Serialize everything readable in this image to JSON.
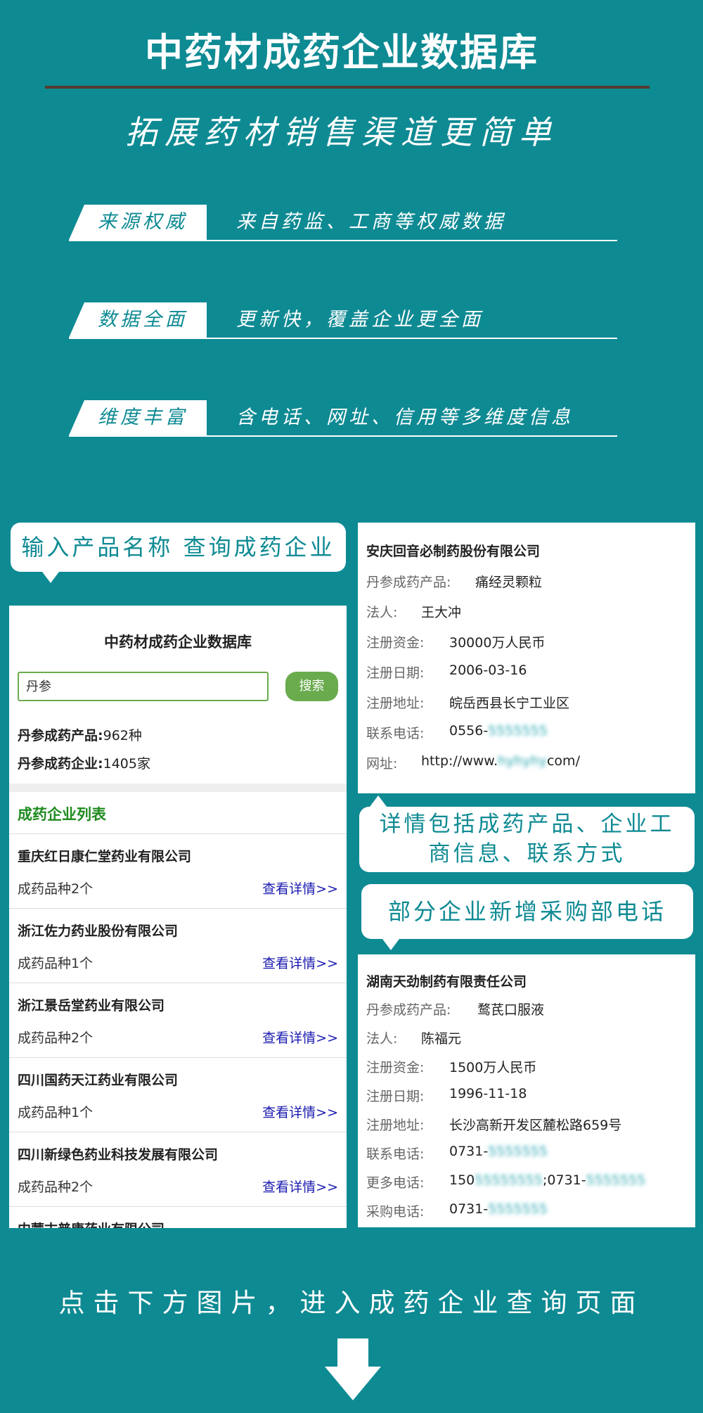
{
  "header": {
    "title": "中药材成药企业数据库",
    "subtitle": "拓展药材销售渠道更简单"
  },
  "features": [
    {
      "tag": "来源权威",
      "desc": "来自药监、工商等权威数据"
    },
    {
      "tag": "数据全面",
      "desc": "更新快，覆盖企业更全面"
    },
    {
      "tag": "维度丰富",
      "desc": "含电话、网址、信用等多维度信息"
    }
  ],
  "callouts": {
    "search_hint": "输入产品名称 查询成药企业",
    "detail_hint_line1": "详情包括成药产品、企业工",
    "detail_hint_line2": "商信息、联系方式",
    "purchase_hint": "部分企业新增采购部电话"
  },
  "search_panel": {
    "title": "中药材成药企业数据库",
    "query": "丹参",
    "search_button": "搜索",
    "product_stat_label": "丹参成药产品:",
    "product_stat_value": "962种",
    "company_stat_label": "丹参成药企业:",
    "company_stat_value": "1405家",
    "list_heading": "成药企业列表",
    "link_label": "查看详情>>",
    "companies": [
      {
        "name": "重庆红日康仁堂药业有限公司",
        "count": "成药品种2个"
      },
      {
        "name": "浙江佐力药业股份有限公司",
        "count": "成药品种1个"
      },
      {
        "name": "浙江景岳堂药业有限公司",
        "count": "成药品种2个"
      },
      {
        "name": "四川国药天江药业有限公司",
        "count": "成药品种1个"
      },
      {
        "name": "四川新绿色药业科技发展有限公司",
        "count": "成药品种2个"
      },
      {
        "name": "内蒙古普康药业有限公司",
        "count": ""
      }
    ]
  },
  "detail_card_1": {
    "company": "安庆回音必制药股份有限公司",
    "rows": [
      {
        "label": "丹参成药产品:",
        "value": "痛经灵颗粒"
      },
      {
        "label": "法人:",
        "value": "王大冲"
      },
      {
        "label": "注册资金:",
        "value": "30000万人民币"
      },
      {
        "label": "注册日期:",
        "value": "2006-03-16"
      },
      {
        "label": "注册地址:",
        "value": "皖岳西县长宁工业区"
      },
      {
        "label": "联系电话:",
        "value": "0556-",
        "blurred": "5555555"
      },
      {
        "label": "网址:",
        "value": "http://www.",
        "blurred": "hyhyhy",
        "suffix": "com/"
      }
    ]
  },
  "detail_card_2": {
    "company": "湖南天劲制药有限责任公司",
    "rows": [
      {
        "label": "丹参成药产品:",
        "value": "鹜芪口服液"
      },
      {
        "label": "法人:",
        "value": "陈福元"
      },
      {
        "label": "注册资金:",
        "value": "1500万人民币"
      },
      {
        "label": "注册日期:",
        "value": "1996-11-18"
      },
      {
        "label": "注册地址:",
        "value": "长沙高新开发区麓松路659号"
      },
      {
        "label": "联系电话:",
        "value": "0731-",
        "blurred": "5555555"
      },
      {
        "label": "更多电话:",
        "value": "150",
        "blurred": "55555555",
        "suffix": ";0731-",
        "blurred2": "5555555"
      },
      {
        "label": "采购电话:",
        "value": "0731-",
        "blurred": "5555555"
      }
    ]
  },
  "footer": {
    "cta": "点击下方图片，进入成药企业查询页面"
  },
  "colors": {
    "background": "#0e8a93",
    "accent_green": "#6aab4e",
    "link_blue": "#1a1ab0"
  }
}
